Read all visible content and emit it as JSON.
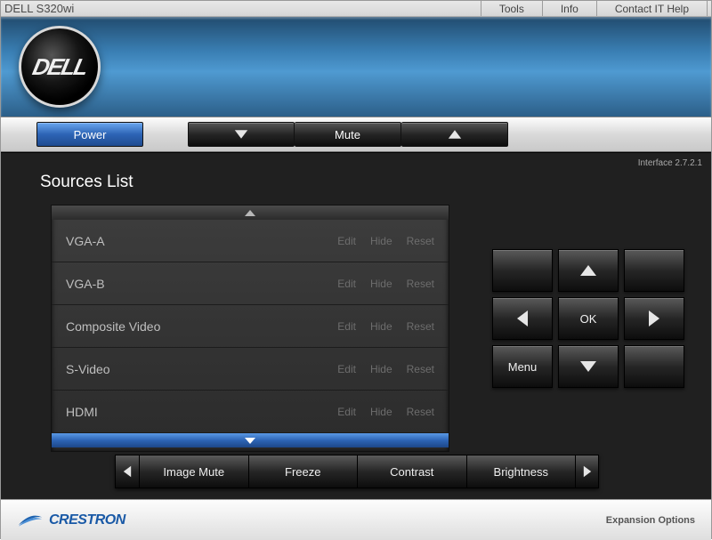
{
  "title": "DELL S320wi",
  "menu": {
    "tools": "Tools",
    "info": "Info",
    "contact": "Contact IT Help"
  },
  "logo_text": "DELL",
  "toolbar": {
    "power": "Power",
    "mute": "Mute"
  },
  "interface_version": "Interface 2.7.2.1",
  "sources": {
    "title": "Sources List",
    "actions": {
      "edit": "Edit",
      "hide": "Hide",
      "reset": "Reset"
    },
    "items": [
      "VGA-A",
      "VGA-B",
      "Composite Video",
      "S-Video",
      "HDMI"
    ]
  },
  "dpad": {
    "ok": "OK",
    "menu": "Menu"
  },
  "bottom": {
    "items": [
      "Image Mute",
      "Freeze",
      "Contrast",
      "Brightness"
    ]
  },
  "footer": {
    "brand": "CRESTRON",
    "expansion": "Expansion Options"
  }
}
